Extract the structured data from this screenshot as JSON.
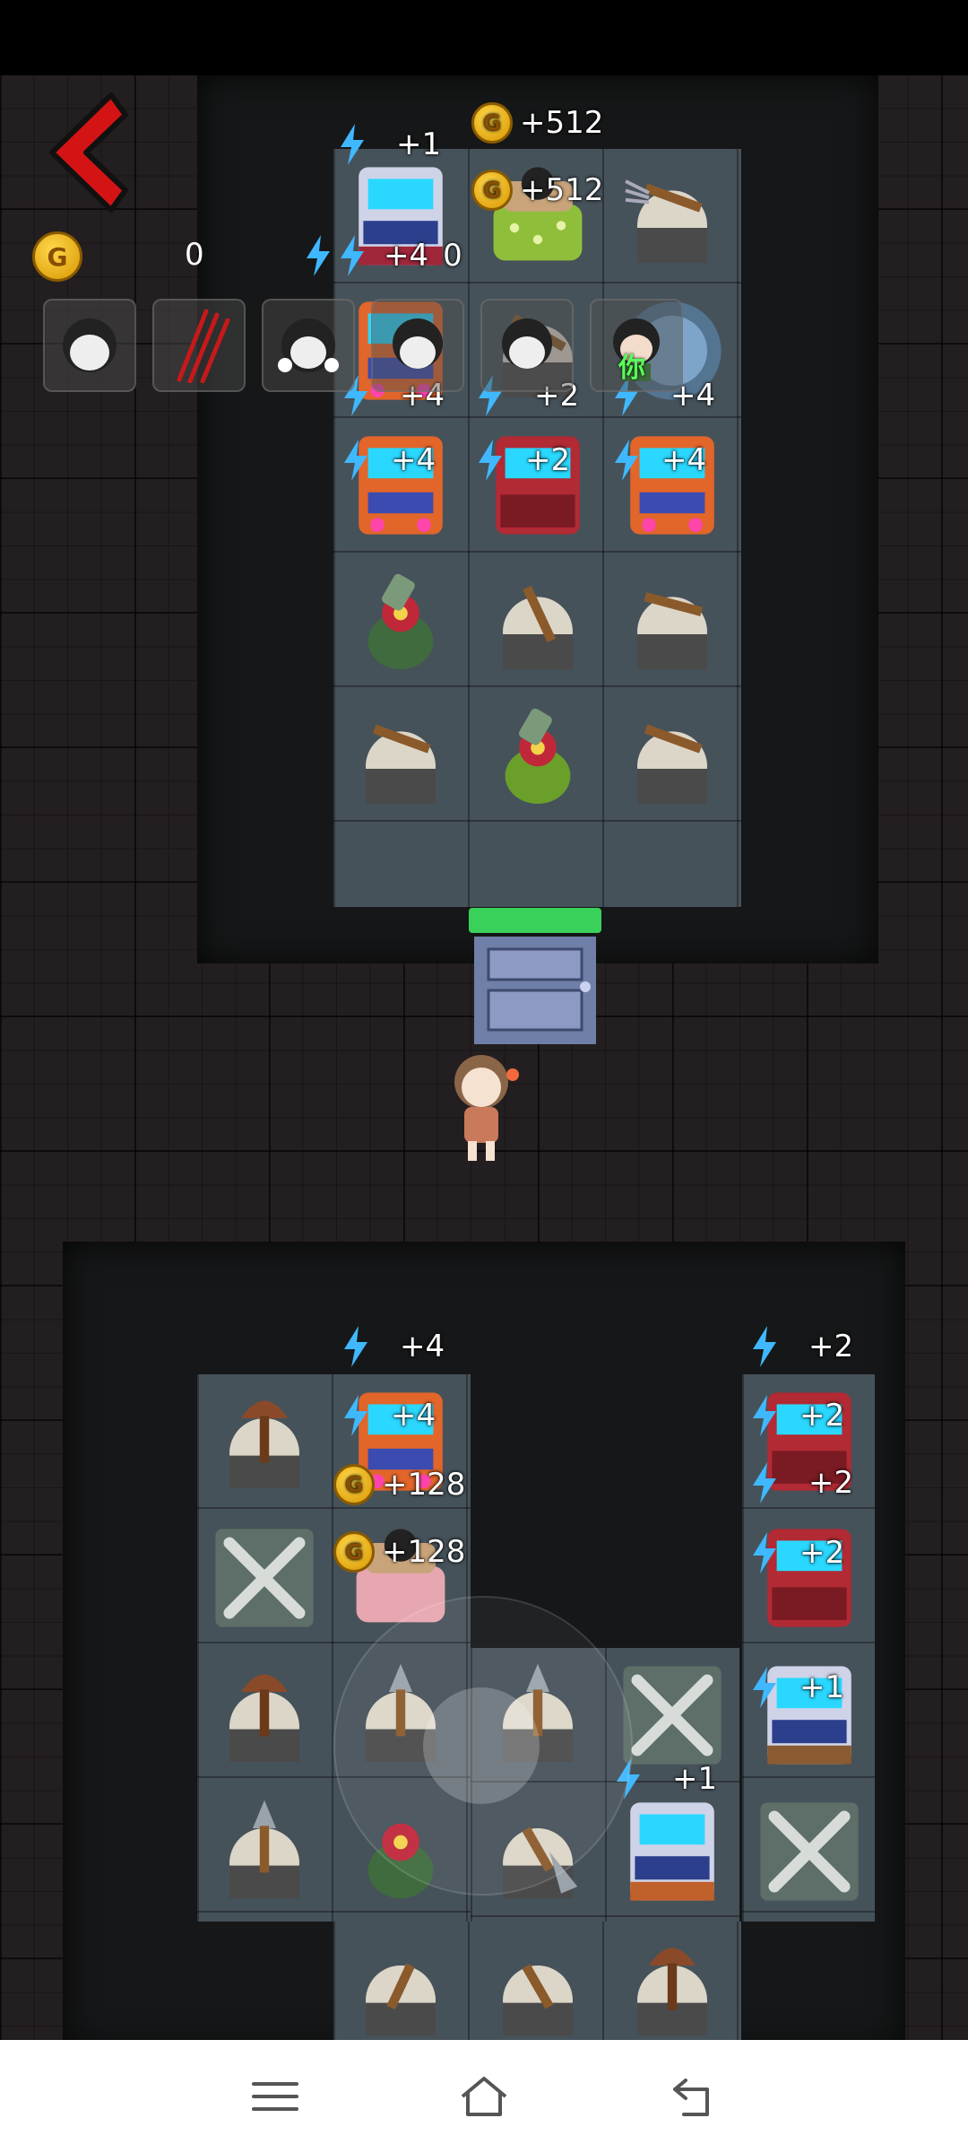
{
  "hud": {
    "gold_value": "0",
    "coin_letter": "G"
  },
  "avatars": [
    {
      "name": "sleepy-girl-avatar"
    },
    {
      "name": "claw-marks-avatar"
    },
    {
      "name": "bow-girl-avatar"
    },
    {
      "name": "smiling-boy-avatar"
    },
    {
      "name": "sleepy-boy-avatar"
    },
    {
      "name": "you-avatar",
      "tag": "你"
    }
  ],
  "top_room": {
    "bed_gain_1": "+512",
    "bed_gain_2": "+512",
    "arcade_labels": [
      "+1",
      "+4",
      "+4",
      "+2",
      "+4",
      "+4",
      "+2",
      "+4"
    ],
    "bed_zero": "0"
  },
  "bottom_left_room": {
    "arcade_labels": [
      "+4",
      "+4"
    ],
    "bed_gain_1": "+128",
    "bed_gain_2": "+128"
  },
  "bottom_right_room": {
    "arcade_labels": [
      "+2",
      "+2",
      "+2",
      "+2",
      "+1",
      "+1"
    ]
  },
  "colors": {
    "accent_red": "#d41414",
    "coin_gold": "#f2b51c",
    "bolt_blue": "#3fb8ff",
    "door_bar_green": "#3ad15a"
  }
}
